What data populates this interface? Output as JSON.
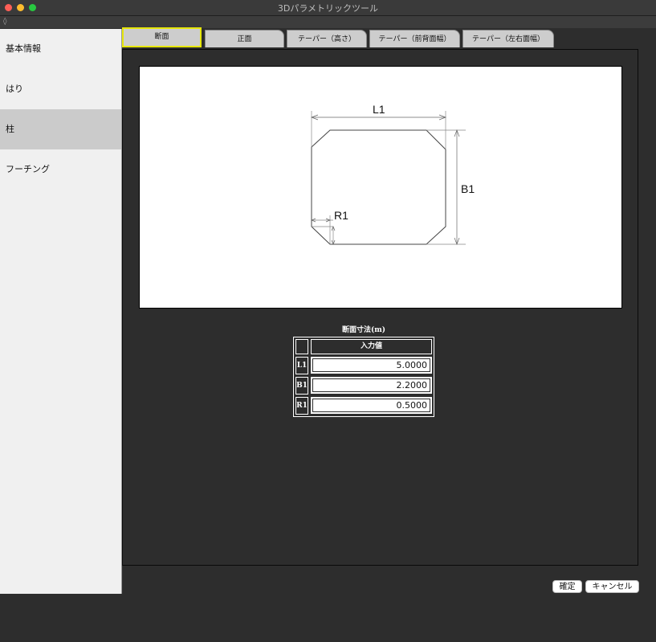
{
  "window": {
    "title": "3Dパラメトリックツール"
  },
  "sidebar": {
    "items": [
      {
        "label": "基本情報"
      },
      {
        "label": "はり"
      },
      {
        "label": "柱"
      },
      {
        "label": "フーチング"
      }
    ]
  },
  "tabs": [
    {
      "label": "断面"
    },
    {
      "label": "正面"
    },
    {
      "label": "テーパー（高さ）"
    },
    {
      "label": "テーパー（前背面幅）"
    },
    {
      "label": "テーパー（左右面幅）"
    }
  ],
  "diagram": {
    "label_l1": "L1",
    "label_b1": "B1",
    "label_r1": "R1"
  },
  "table": {
    "title": "断面寸法(m)",
    "header": "入力値",
    "rows": [
      {
        "label": "L1",
        "value": "5.0000"
      },
      {
        "label": "B1",
        "value": "2.2000"
      },
      {
        "label": "R1",
        "value": "0.5000"
      }
    ]
  },
  "buttons": {
    "confirm": "確定",
    "cancel": "キャンセル"
  }
}
